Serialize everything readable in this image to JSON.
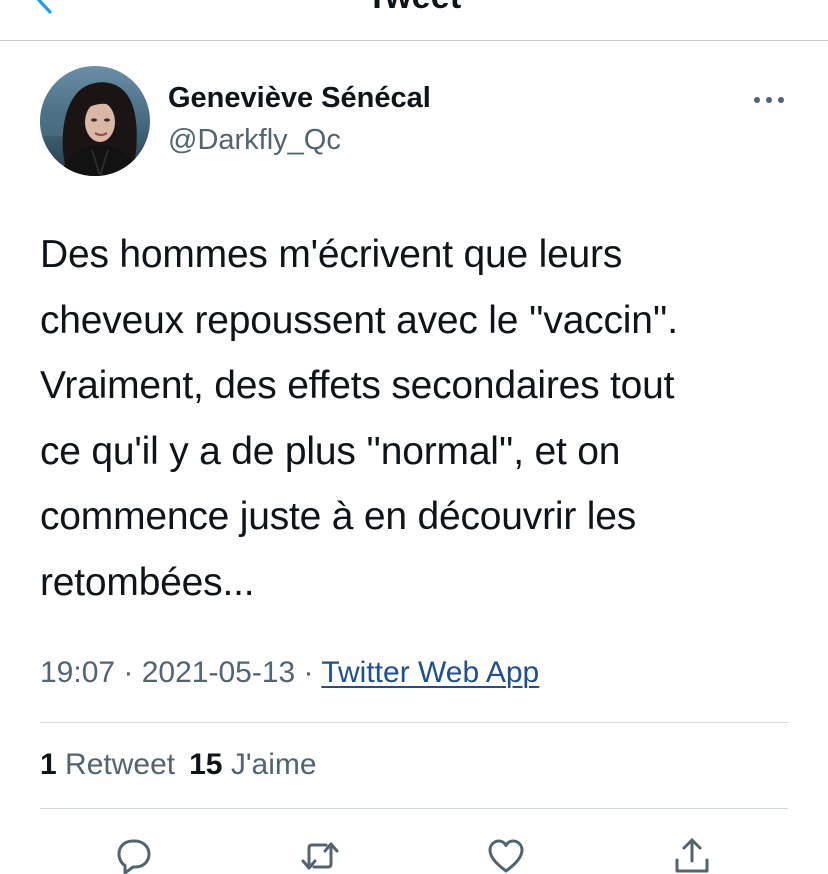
{
  "nav": {
    "title": "Tweet",
    "back_icon": "chevron-left-icon"
  },
  "author": {
    "display_name": "Geneviève Sénécal",
    "handle": "@Darkfly_Qc",
    "avatar_icon": "profile-photo"
  },
  "tweet": {
    "text": "Des hommes m'écrivent que leurs\ncheveux repoussent avec le ''vaccin''.\nVraiment, des effets secondaires tout\nce qu'il y a de plus ''normal'', et on\ncommence juste à en découvrir les\nretombées...",
    "time": "19:07",
    "separator": " · ",
    "date": "2021-05-13",
    "source": "Twitter Web App"
  },
  "stats": {
    "retweet_count": "1",
    "retweet_label": "Retweet",
    "like_count": "15",
    "like_label": "J'aime"
  },
  "actions": {
    "reply_icon": "comment-icon",
    "retweet_icon": "retweet-icon",
    "like_icon": "heart-icon",
    "share_icon": "share-icon",
    "more_icon": "more-horizontal-icon"
  },
  "colors": {
    "text_primary": "#0f1419",
    "text_secondary": "#536471",
    "link": "#1d4f91",
    "divider": "#cfd9de"
  }
}
